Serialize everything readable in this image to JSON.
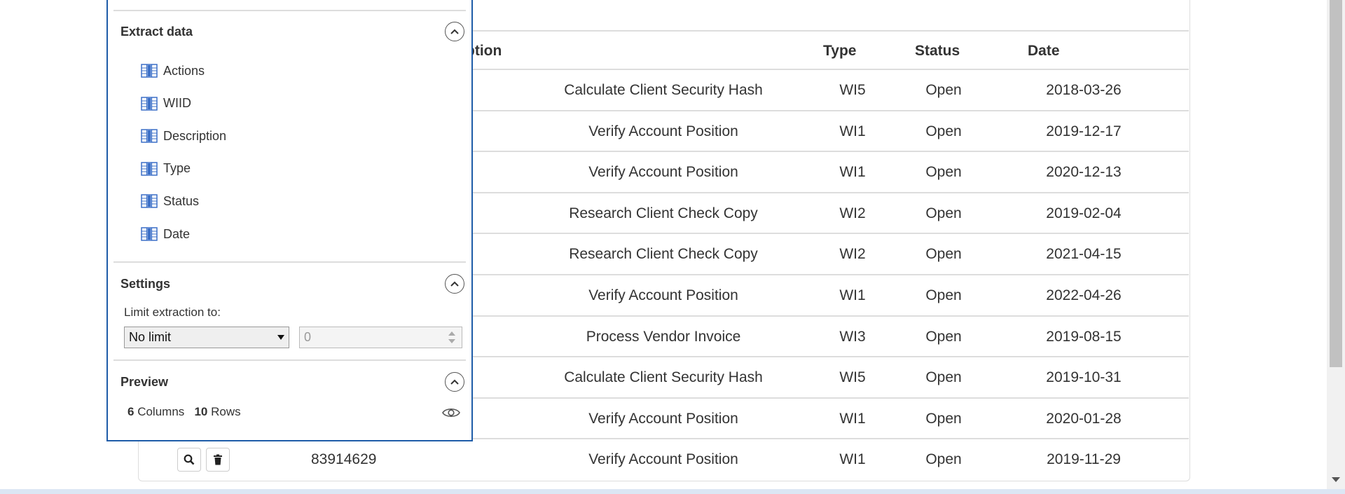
{
  "table": {
    "headers": {
      "description": "ption",
      "type": "Type",
      "status": "Status",
      "date": "Date"
    },
    "rows": [
      {
        "wiid": "",
        "description": "Calculate Client Security Hash",
        "type": "WI5",
        "status": "Open",
        "date": "2018-03-26"
      },
      {
        "wiid": "",
        "description": "Verify Account Position",
        "type": "WI1",
        "status": "Open",
        "date": "2019-12-17"
      },
      {
        "wiid": "",
        "description": "Verify Account Position",
        "type": "WI1",
        "status": "Open",
        "date": "2020-12-13"
      },
      {
        "wiid": "",
        "description": "Research Client Check Copy",
        "type": "WI2",
        "status": "Open",
        "date": "2019-02-04"
      },
      {
        "wiid": "",
        "description": "Research Client Check Copy",
        "type": "WI2",
        "status": "Open",
        "date": "2021-04-15"
      },
      {
        "wiid": "",
        "description": "Verify Account Position",
        "type": "WI1",
        "status": "Open",
        "date": "2022-04-26"
      },
      {
        "wiid": "",
        "description": "Process Vendor Invoice",
        "type": "WI3",
        "status": "Open",
        "date": "2019-08-15"
      },
      {
        "wiid": "",
        "description": "Calculate Client Security Hash",
        "type": "WI5",
        "status": "Open",
        "date": "2019-10-31"
      },
      {
        "wiid": "",
        "description": "Verify Account Position",
        "type": "WI1",
        "status": "Open",
        "date": "2020-01-28"
      },
      {
        "wiid": "83914629",
        "description": "Verify Account Position",
        "type": "WI1",
        "status": "Open",
        "date": "2019-11-29"
      }
    ]
  },
  "panel": {
    "extract_title": "Extract data",
    "fields": [
      "Actions",
      "WIID",
      "Description",
      "Type",
      "Status",
      "Date"
    ],
    "settings_title": "Settings",
    "limit_label": "Limit extraction to:",
    "limit_select": "No limit",
    "limit_number": "0",
    "preview_title": "Preview",
    "columns_count": "6",
    "columns_word": "Columns",
    "rows_count": "10",
    "rows_word": "Rows"
  },
  "colors": {
    "panel_border": "#1e5ca8",
    "icon_blue": "#3b6fc7"
  }
}
